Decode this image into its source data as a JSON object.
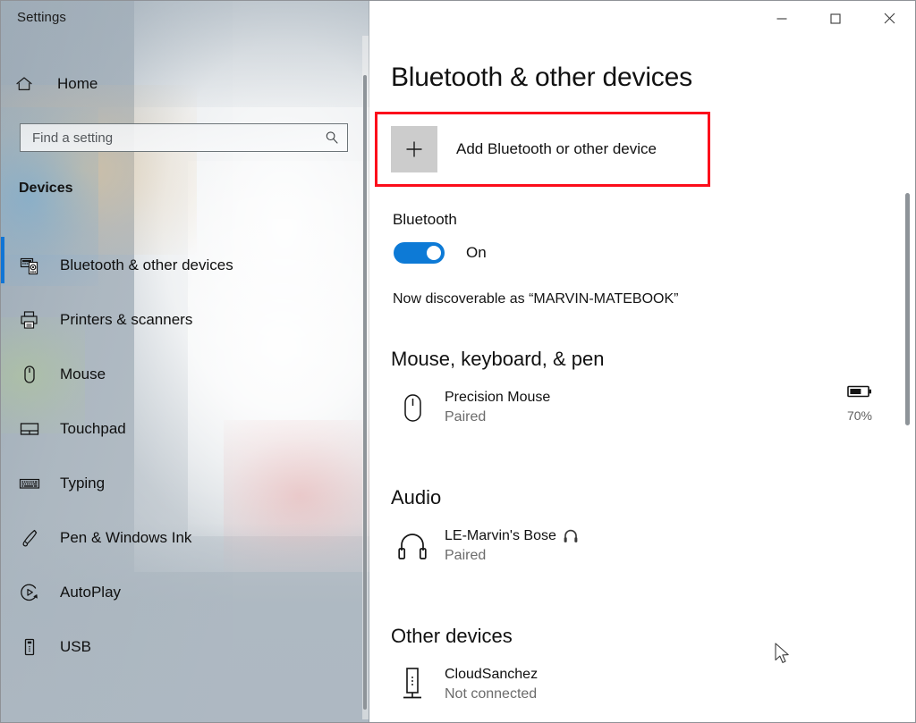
{
  "window": {
    "title": "Settings",
    "caption_buttons": [
      {
        "name": "minimize",
        "glyph": "minimize-icon"
      },
      {
        "name": "maximize",
        "glyph": "maximize-icon"
      },
      {
        "name": "close",
        "glyph": "close-icon"
      }
    ]
  },
  "sidebar": {
    "home_label": "Home",
    "home_icon": "home-icon",
    "search": {
      "placeholder": "Find a setting",
      "value": "",
      "icon": "search-icon"
    },
    "section_heading": "Devices",
    "selected_index": 0,
    "accent_color": "#1175d5",
    "items": [
      {
        "label": "Bluetooth & other devices",
        "icon": "bluetooth-devices-icon",
        "selected": true
      },
      {
        "label": "Printers & scanners",
        "icon": "printer-icon",
        "selected": false
      },
      {
        "label": "Mouse",
        "icon": "mouse-icon",
        "selected": false
      },
      {
        "label": "Touchpad",
        "icon": "touchpad-icon",
        "selected": false
      },
      {
        "label": "Typing",
        "icon": "keyboard-icon",
        "selected": false
      },
      {
        "label": "Pen & Windows Ink",
        "icon": "pen-icon",
        "selected": false
      },
      {
        "label": "AutoPlay",
        "icon": "autoplay-icon",
        "selected": false
      },
      {
        "label": "USB",
        "icon": "usb-icon",
        "selected": false
      }
    ]
  },
  "main": {
    "page_title": "Bluetooth & other devices",
    "add_device": {
      "label": "Add Bluetooth or other device",
      "icon": "plus-icon",
      "highlighted": true,
      "highlight_color": "#fc0d1b"
    },
    "bluetooth": {
      "label": "Bluetooth",
      "state": "On",
      "toggle_on": true,
      "toggle_color": "#0d7ad6",
      "discoverable_text": "Now discoverable as “MARVIN-MATEBOOK”"
    },
    "groups": [
      {
        "heading": "Mouse, keyboard, & pen",
        "devices": [
          {
            "name": "Precision Mouse",
            "status": "Paired",
            "icon": "mouse-device-icon",
            "battery_percent": "70%",
            "battery_level": 70,
            "battery_icon": "battery-icon"
          }
        ]
      },
      {
        "heading": "Audio",
        "devices": [
          {
            "name": "LE-Marvin's Bose",
            "name_suffix_icon": "headphones-glyph-icon",
            "status": "Paired",
            "icon": "headphones-device-icon"
          }
        ]
      },
      {
        "heading": "Other devices",
        "devices": [
          {
            "name": "CloudSanchez",
            "status": "Not connected",
            "icon": "generic-device-icon"
          }
        ]
      }
    ]
  }
}
